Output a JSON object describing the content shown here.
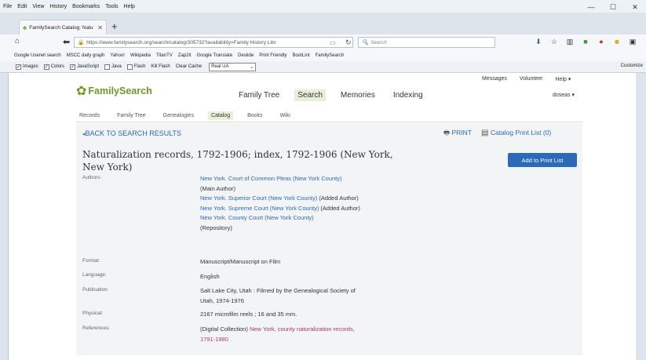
{
  "menu": [
    "File",
    "Edit",
    "View",
    "History",
    "Bookmarks",
    "Tools",
    "Help"
  ],
  "tab": {
    "title": "FamilySearch Catalog: Natu"
  },
  "url": "https://www.familysearch.org/search/catalog/305732?availability=Family History Libr",
  "search_placeholder": "Search",
  "bookmarks": [
    "Google Usenet search",
    "MSCC daily graph",
    "Yahoo!",
    "Wikipedia",
    "TitanTV",
    "Zap2it",
    "Google Translate",
    "Deslide",
    "Print Friendly",
    "BootLint",
    "FamilySearch"
  ],
  "toolbar2": {
    "checks": [
      {
        "label": "Images",
        "checked": true
      },
      {
        "label": "Colors",
        "checked": true
      },
      {
        "label": "JavaScript",
        "checked": true
      },
      {
        "label": "Java",
        "checked": false
      },
      {
        "label": "Flash",
        "checked": false
      }
    ],
    "kill_flash": "Kill Flash",
    "clear_cache": "Clear Cache",
    "ua": "Real UA",
    "customize": "Customize"
  },
  "site": {
    "logo": "FamilySearch",
    "nav": [
      "Family Tree",
      "Search",
      "Memories",
      "Indexing"
    ],
    "active_nav": "Search",
    "top_links": [
      "Messages",
      "Volunteer",
      "Help ▾"
    ],
    "user": "doseas ▾",
    "subnav": [
      "Records",
      "Family Tree",
      "Genealogies",
      "Catalog",
      "Books",
      "Wiki"
    ],
    "active_subnav": "Catalog"
  },
  "backlink": "BACK TO SEARCH RESULTS",
  "print": "PRINT",
  "print_list": "Catalog Print List (0)",
  "record": {
    "title": "Naturalization records, 1792-1906; index, 1792-1906 (New York, New York)",
    "add_button": "Add to Print List",
    "authors_label": "Authors:",
    "authors": [
      {
        "name": "New York. Court of Common Pleas (New York County)",
        "role": "(Main Author)"
      },
      {
        "name": "New York. Superior Court (New York County)",
        "role": "(Added Author)"
      },
      {
        "name": "New York. Supreme Court (New York County)",
        "role": "(Added Author)"
      },
      {
        "name": "New York. County Court (New York County)",
        "role": "(Repository)"
      }
    ],
    "format_label": "Format:",
    "format": "Manuscript/Manuscript on Film",
    "language_label": "Language:",
    "language": "English",
    "publication_label": "Publication:",
    "publication": "Salt Lake City, Utah : Filmed by the Genealogical Society of Utah, 1974-1976",
    "physical_label": "Physical:",
    "physical": "2167 microfilm reels ; 16 and 35 mm.",
    "references_label": "References:",
    "references_prefix": "(Digital Collection)",
    "references_link": "New York, county naturalization records, 1791-1980"
  }
}
